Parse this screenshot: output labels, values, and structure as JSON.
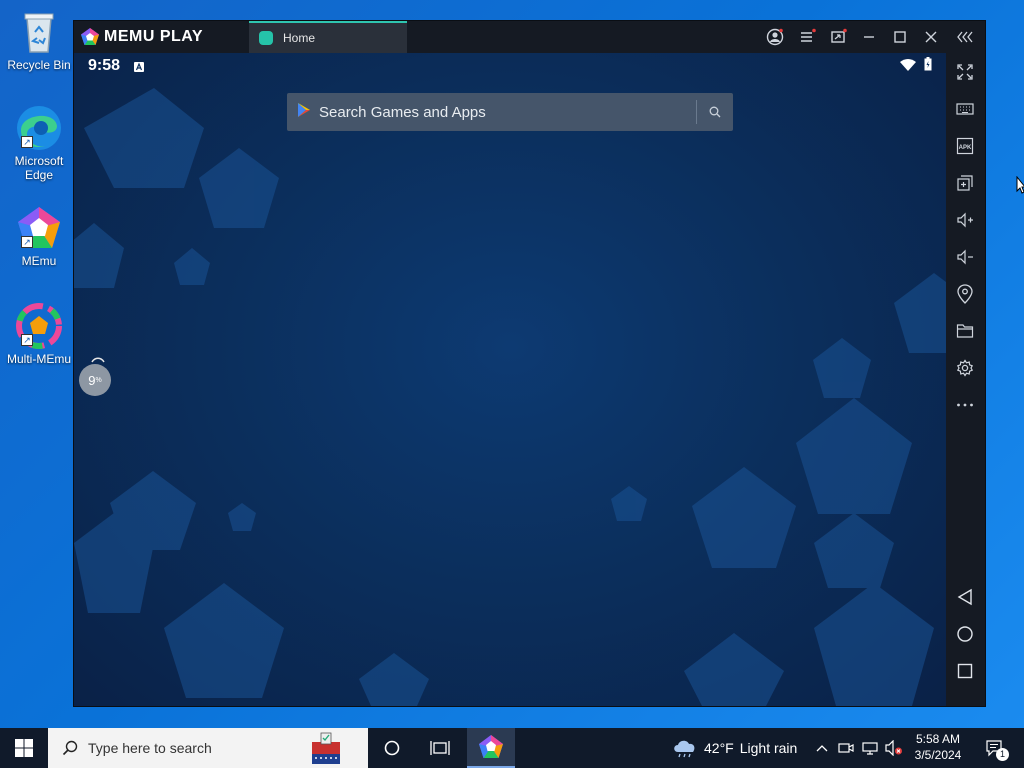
{
  "desktop": {
    "icons": [
      {
        "label": "Recycle Bin"
      },
      {
        "label": "Microsoft Edge"
      },
      {
        "label": "MEmu"
      },
      {
        "label": "Multi-MEmu"
      }
    ]
  },
  "memu": {
    "brand": "MEMU PLAY",
    "tab_label": "Home",
    "status_time": "9:58",
    "search_placeholder": "Search Games and Apps",
    "progress_text": "9",
    "progress_unit": "%"
  },
  "taskbar": {
    "search_placeholder": "Type here to search",
    "weather_temp": "42°F",
    "weather_desc": "Light rain",
    "time": "5:58 AM",
    "date": "3/5/2024",
    "notification_count": "1"
  },
  "colors": {
    "accent": "#2fc6b0",
    "window_bg": "#151a23",
    "screen_bg": "#0b2f5d",
    "taskbar_bg": "#101a2a"
  }
}
